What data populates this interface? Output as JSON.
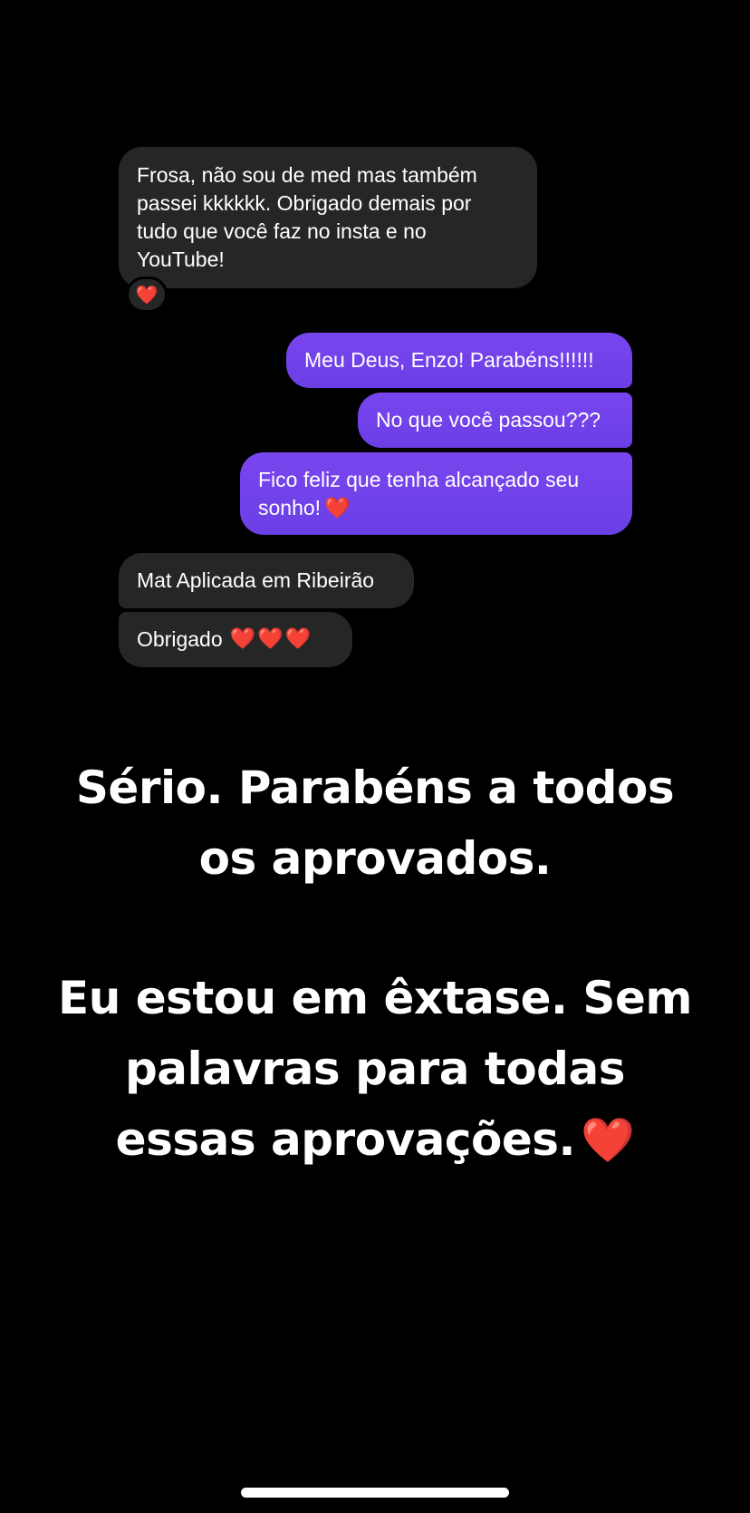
{
  "messages": [
    {
      "direction": "incoming",
      "lines": [
        "Frosa,  não sou de med mas também",
        "passei kkkkkk. Obrigado demais por",
        "tudo que você faz no insta e no",
        "YouTube!"
      ],
      "reaction": "❤️"
    },
    {
      "direction": "outgoing",
      "text": "Meu Deus, Enzo! Parabéns!!!!!!"
    },
    {
      "direction": "outgoing",
      "text": "No que você passou???"
    },
    {
      "direction": "outgoing",
      "lines": [
        "Fico feliz que tenha alcançado seu",
        "sonho!"
      ],
      "emoji": "❤️"
    },
    {
      "direction": "incoming",
      "text": "Mat Aplicada em Ribeirão"
    },
    {
      "direction": "incoming",
      "text": "Obrigado",
      "emoji": "❤️❤️❤️"
    }
  ],
  "caption": {
    "paragraph1": [
      "Sério. Parabéns a todos",
      "os aprovados."
    ],
    "paragraph2": [
      "Eu estou em êxtase. Sem",
      "palavras para todas",
      "essas aprovações."
    ],
    "emoji": "❤️"
  },
  "colors": {
    "background": "#000000",
    "incoming_bubble": "#262626",
    "outgoing_bubble": "#7a45ee",
    "heart": "#e2253c",
    "text": "#ffffff"
  },
  "icons": {
    "heart": "heart-icon",
    "home_indicator": "home-indicator-bar"
  }
}
